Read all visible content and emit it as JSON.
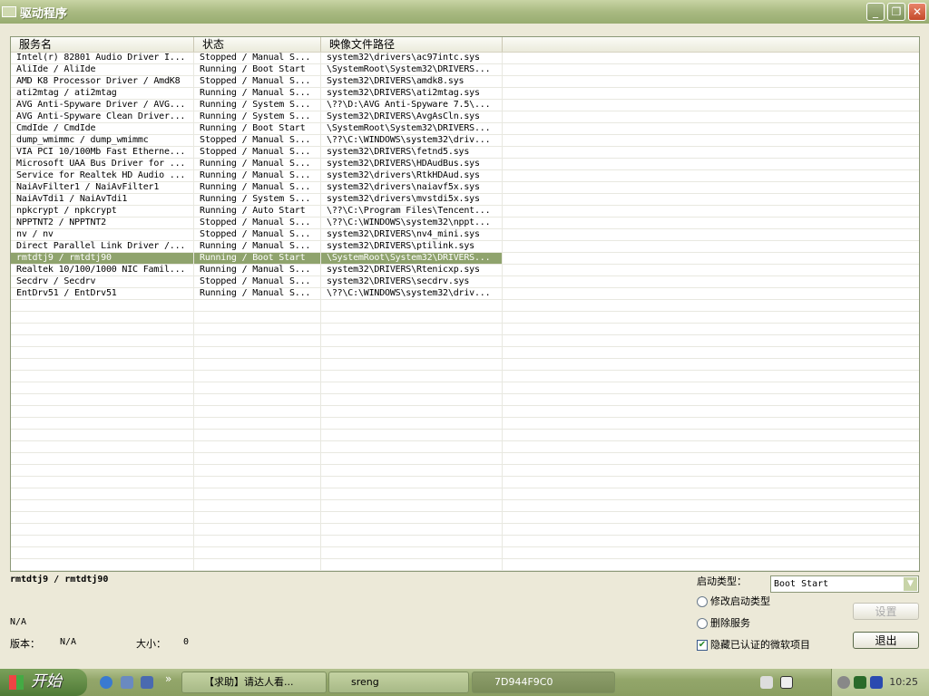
{
  "window": {
    "title": "驱动程序",
    "minimize": "_",
    "restore": "❐",
    "close": "✕"
  },
  "columns": [
    "服务名",
    "状态",
    "映像文件路径"
  ],
  "rows": [
    [
      "Intel(r) 82801 Audio Driver I...",
      "Stopped / Manual S...",
      "system32\\drivers\\ac97intc.sys"
    ],
    [
      "AliIde / AliIde",
      "Running / Boot Start",
      "\\SystemRoot\\System32\\DRIVERS..."
    ],
    [
      "AMD K8 Processor Driver / AmdK8",
      "Stopped / Manual S...",
      "System32\\DRIVERS\\amdk8.sys"
    ],
    [
      "ati2mtag / ati2mtag",
      "Running / Manual S...",
      "system32\\DRIVERS\\ati2mtag.sys"
    ],
    [
      "AVG Anti-Spyware Driver / AVG...",
      "Running / System S...",
      "\\??\\D:\\AVG Anti-Spyware 7.5\\..."
    ],
    [
      "AVG Anti-Spyware Clean Driver...",
      "Running / System S...",
      "System32\\DRIVERS\\AvgAsCln.sys"
    ],
    [
      "CmdIde / CmdIde",
      "Running / Boot Start",
      "\\SystemRoot\\System32\\DRIVERS..."
    ],
    [
      "dump_wmimmc / dump_wmimmc",
      "Stopped / Manual S...",
      "\\??\\C:\\WINDOWS\\system32\\driv..."
    ],
    [
      "VIA PCI 10/100Mb Fast Etherne...",
      "Stopped / Manual S...",
      "system32\\DRIVERS\\fetnd5.sys"
    ],
    [
      "Microsoft UAA Bus Driver for ...",
      "Running / Manual S...",
      "system32\\DRIVERS\\HDAudBus.sys"
    ],
    [
      "Service for Realtek HD Audio ...",
      "Running / Manual S...",
      "system32\\drivers\\RtkHDAud.sys"
    ],
    [
      "NaiAvFilter1 / NaiAvFilter1",
      "Running / Manual S...",
      "system32\\drivers\\naiavf5x.sys"
    ],
    [
      "NaiAvTdi1 / NaiAvTdi1",
      "Running / System S...",
      "system32\\drivers\\mvstdi5x.sys"
    ],
    [
      "npkcrypt / npkcrypt",
      "Running / Auto Start",
      "\\??\\C:\\Program Files\\Tencent..."
    ],
    [
      "NPPTNT2 / NPPTNT2",
      "Stopped / Manual S...",
      "\\??\\C:\\WINDOWS\\system32\\nppt..."
    ],
    [
      "nv / nv",
      "Stopped / Manual S...",
      "system32\\DRIVERS\\nv4_mini.sys"
    ],
    [
      "Direct Parallel Link Driver /...",
      "Running / Manual S...",
      "system32\\DRIVERS\\ptilink.sys"
    ],
    [
      "rmtdtj9 / rmtdtj90",
      "Running / Boot Start",
      "\\SystemRoot\\System32\\DRIVERS..."
    ],
    [
      "Realtek 10/100/1000 NIC Famil...",
      "Running / Manual S...",
      "system32\\DRIVERS\\Rtenicxp.sys"
    ],
    [
      "Secdrv / Secdrv",
      "Stopped / Manual S...",
      "system32\\DRIVERS\\secdrv.sys"
    ],
    [
      "EntDrv51 / EntDrv51",
      "Running / Manual S...",
      "\\??\\C:\\WINDOWS\\system32\\driv..."
    ]
  ],
  "selected_index": 17,
  "details": {
    "name": "rmtdtj9 / rmtdtj90",
    "description": "N/A",
    "version_label": "版本：",
    "version": "N/A",
    "size_label": "大小：",
    "size": "0"
  },
  "controls": {
    "start_type_label": "启动类型：",
    "start_type_value": "Boot Start",
    "modify_start_type": "修改启动类型",
    "delete_service": "删除服务",
    "hide_ms": "隐藏已认证的微软项目",
    "hide_ms_checked": true,
    "set_button": "设置",
    "exit_button": "退出"
  },
  "taskbar": {
    "start": "开始",
    "chevron": "»",
    "tasks": [
      "【求助】请达人看...",
      "sreng",
      "7D944F9C0"
    ],
    "clock": "10:25"
  }
}
